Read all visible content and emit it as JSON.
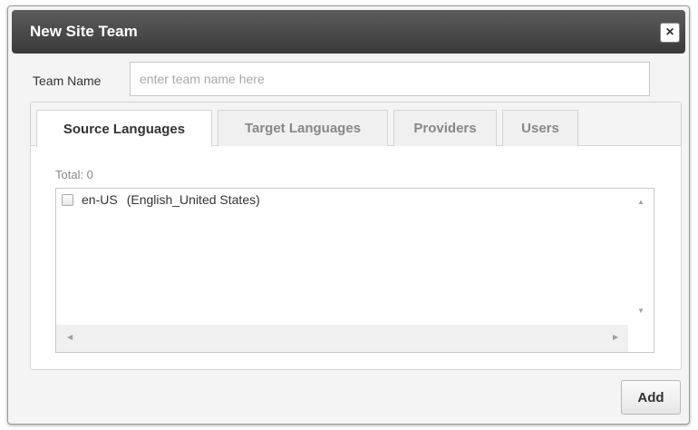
{
  "dialog": {
    "title": "New Site Team",
    "close_label": "×"
  },
  "team_name": {
    "label": "Team Name",
    "value": "",
    "placeholder": "enter team name here"
  },
  "tabs": [
    {
      "label": "Source Languages",
      "active": true
    },
    {
      "label": "Target Languages",
      "active": false
    },
    {
      "label": "Providers",
      "active": false
    },
    {
      "label": "Users",
      "active": false
    }
  ],
  "source_languages": {
    "total_label": "Total: 0",
    "items": [
      {
        "code": "en-US",
        "name": "(English_United States)",
        "checked": false
      }
    ]
  },
  "footer": {
    "add_label": "Add"
  },
  "icons": {
    "close": "close-icon",
    "scroll_up": "scroll-up-arrow-icon",
    "scroll_down": "scroll-down-arrow-icon",
    "scroll_left": "scroll-left-arrow-icon",
    "scroll_right": "scroll-right-arrow-icon"
  }
}
